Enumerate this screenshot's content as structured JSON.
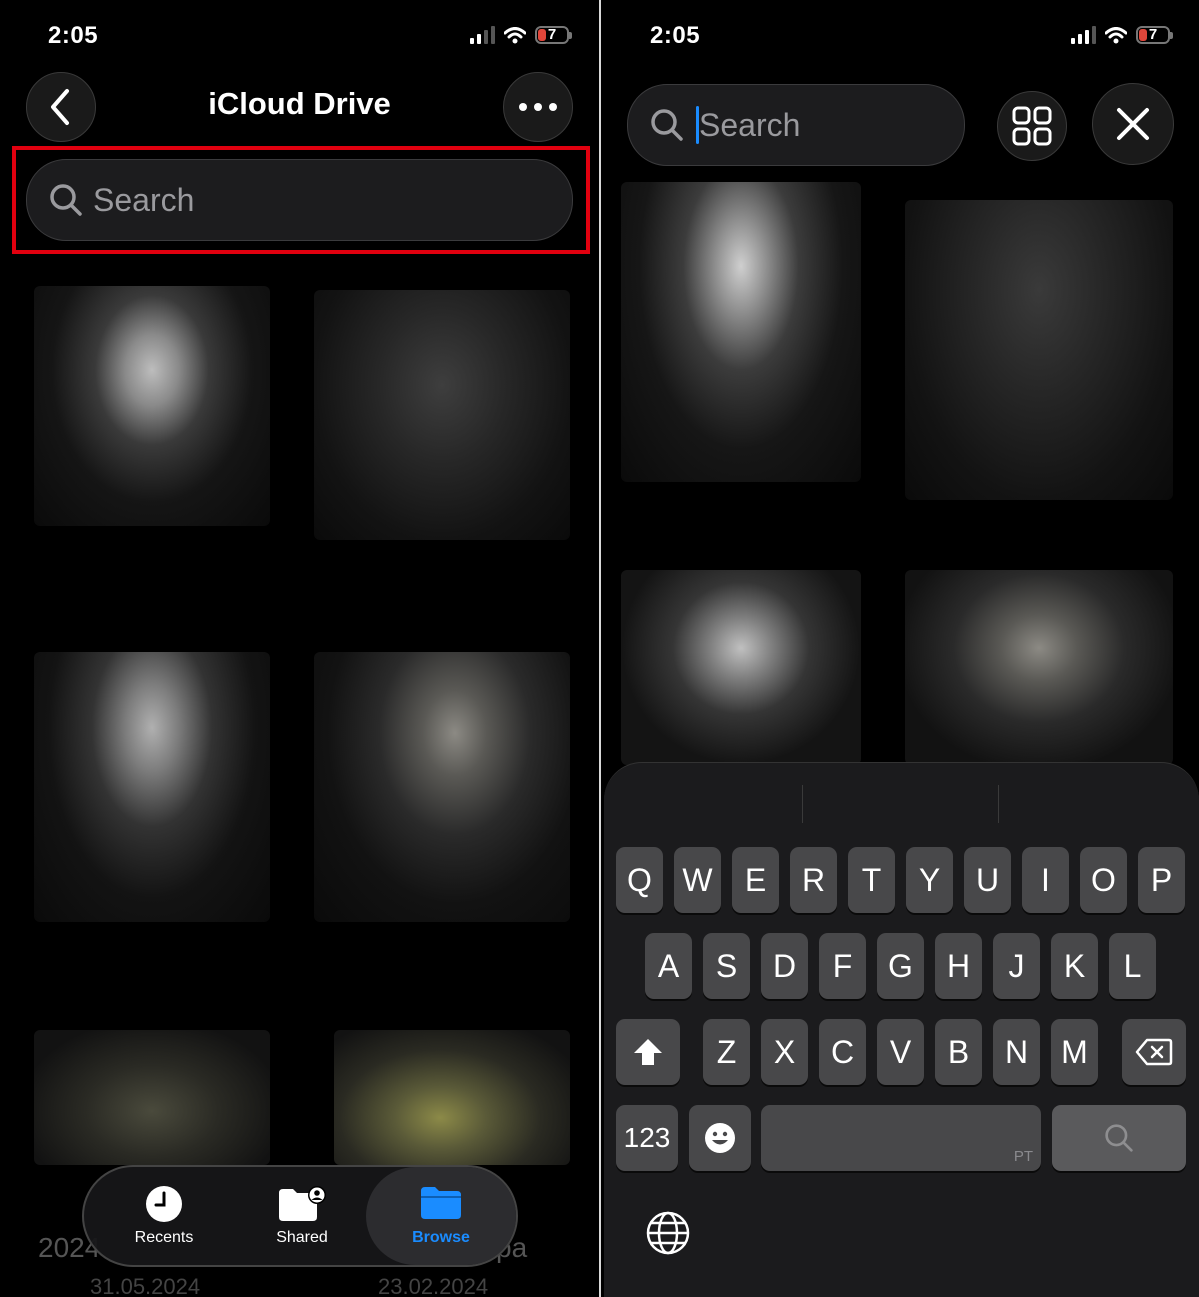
{
  "left": {
    "status": {
      "time": "2:05",
      "battery": "7"
    },
    "nav": {
      "title": "iCloud Drive"
    },
    "search": {
      "placeholder": "Search"
    },
    "background": {
      "item_labels": [
        "2024",
        "pa"
      ],
      "item_dates": [
        "31.05.2024",
        "23.02.2024"
      ]
    },
    "tabs": [
      {
        "label": "Recents",
        "icon": "clock-icon",
        "active": false
      },
      {
        "label": "Shared",
        "icon": "shared-folder-icon",
        "active": false
      },
      {
        "label": "Browse",
        "icon": "folder-icon",
        "active": true
      }
    ],
    "accent": "#1a8cff",
    "highlight_color": "#e1000f"
  },
  "right": {
    "status": {
      "time": "2:05",
      "battery": "7"
    },
    "search": {
      "placeholder": "Search"
    },
    "keyboard": {
      "row1": [
        "Q",
        "W",
        "E",
        "R",
        "T",
        "Y",
        "U",
        "I",
        "O",
        "P"
      ],
      "row2": [
        "A",
        "S",
        "D",
        "F",
        "G",
        "H",
        "J",
        "K",
        "L"
      ],
      "row3": [
        "Z",
        "X",
        "C",
        "V",
        "B",
        "N",
        "M"
      ],
      "numbers_label": "123",
      "space_language": "PT"
    }
  }
}
